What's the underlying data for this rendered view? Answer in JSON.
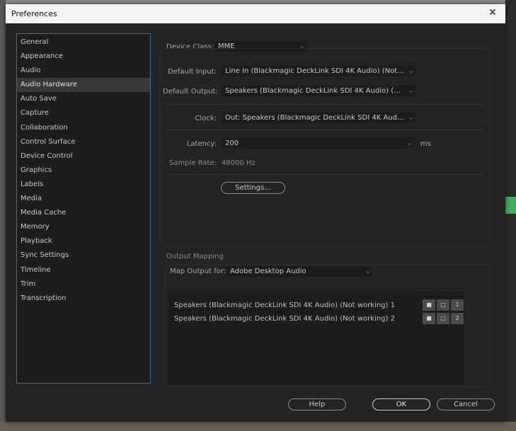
{
  "window": {
    "title": "Preferences",
    "close_label": "✕"
  },
  "sidebar": {
    "selected": "Audio Hardware",
    "items": [
      {
        "label": "General"
      },
      {
        "label": "Appearance"
      },
      {
        "label": "Audio"
      },
      {
        "label": "Audio Hardware"
      },
      {
        "label": "Auto Save"
      },
      {
        "label": "Capture"
      },
      {
        "label": "Collaboration"
      },
      {
        "label": "Control Surface"
      },
      {
        "label": "Device Control"
      },
      {
        "label": "Graphics"
      },
      {
        "label": "Labels"
      },
      {
        "label": "Media"
      },
      {
        "label": "Media Cache"
      },
      {
        "label": "Memory"
      },
      {
        "label": "Playback"
      },
      {
        "label": "Sync Settings"
      },
      {
        "label": "Timeline"
      },
      {
        "label": "Trim"
      },
      {
        "label": "Transcription"
      }
    ]
  },
  "audio_hardware": {
    "device_class": {
      "label": "Device Class:",
      "value": "MME"
    },
    "default_input": {
      "label": "Default Input:",
      "value": "Line In (Blackmagic DeckLink SDI 4K Audio) (Not wor..."
    },
    "default_output": {
      "label": "Default Output:",
      "value": "Speakers (Blackmagic DeckLink SDI 4K Audio) (Not ..."
    },
    "clock": {
      "label": "Clock:",
      "value": "Out: Speakers (Blackmagic DeckLink SDI 4K Audio) (..."
    },
    "latency": {
      "label": "Latency:",
      "value": "200",
      "unit": "ms"
    },
    "sample_rate": {
      "label": "Sample Rate:",
      "value": "48000 Hz"
    },
    "settings_button": "Settings..."
  },
  "output_mapping": {
    "heading": "Output Mapping",
    "map_output_label": "Map Output for:",
    "map_output_value": "Adobe Desktop Audio",
    "rows": [
      {
        "label": "Speakers (Blackmagic DeckLink SDI 4K Audio) (Not working) 1",
        "channel": "1"
      },
      {
        "label": "Speakers (Blackmagic DeckLink SDI 4K Audio) (Not working) 2",
        "channel": "2"
      }
    ]
  },
  "footer": {
    "help": "Help",
    "ok": "OK",
    "cancel": "Cancel"
  },
  "colors": {
    "window_bg": "#232323",
    "titlebar_bg": "#f3f3f3",
    "selection_border": "#2f6fb3",
    "background_green": "#3fae5f"
  },
  "icons": {
    "chevron": "chevron-down-icon",
    "speaker": "speaker-icon",
    "frame": "frame-icon",
    "close": "close-icon"
  }
}
